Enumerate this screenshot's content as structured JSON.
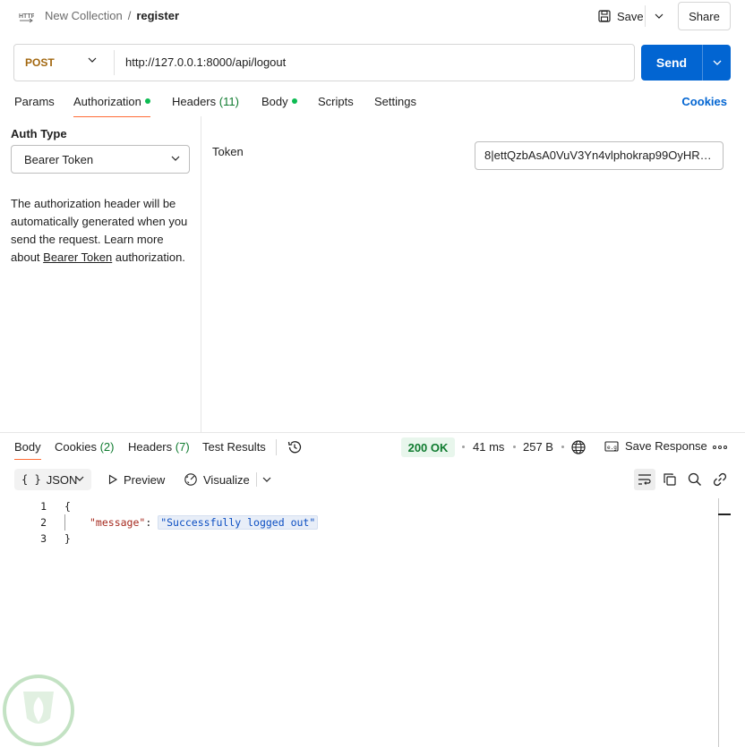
{
  "header": {
    "collection": "New Collection",
    "separator": "/",
    "request_name": "register",
    "save_label": "Save",
    "share_label": "Share"
  },
  "request": {
    "method": "POST",
    "url": "http://127.0.0.1:8000/api/logout",
    "send_label": "Send"
  },
  "tabs": {
    "params": "Params",
    "authorization": "Authorization",
    "headers": "Headers",
    "headers_count": "(11)",
    "body": "Body",
    "scripts": "Scripts",
    "settings": "Settings",
    "cookies": "Cookies"
  },
  "auth": {
    "type_label": "Auth Type",
    "type_value": "Bearer Token",
    "help_before": "The authorization header will be automatically generated when you send the request. Learn more about ",
    "help_link": "Bearer Token",
    "help_after": " authorization.",
    "token_label": "Token",
    "token_value": "8|ettQzbAsA0VuV3Yn4vlphokrap99OyHRK..."
  },
  "response": {
    "tabs": {
      "body": "Body",
      "cookies": "Cookies",
      "cookies_count": "(2)",
      "headers": "Headers",
      "headers_count": "(7)",
      "test_results": "Test Results"
    },
    "status": "200 OK",
    "time": "41 ms",
    "size": "257 B",
    "save_response": "Save Response",
    "format": "JSON",
    "format_brace": "{ }",
    "preview": "Preview",
    "visualize": "Visualize",
    "lines": [
      {
        "num": "1",
        "text": "{"
      },
      {
        "num": "2",
        "key": "\"message\"",
        "colon": ":",
        "value": "\"Successfully logged out\""
      },
      {
        "num": "3",
        "text": "}"
      }
    ]
  },
  "colors": {
    "accent_orange": "#ff6c37",
    "send_blue": "#0265d2",
    "status_green": "#0f7b2f",
    "method_post": "#a2670f"
  }
}
